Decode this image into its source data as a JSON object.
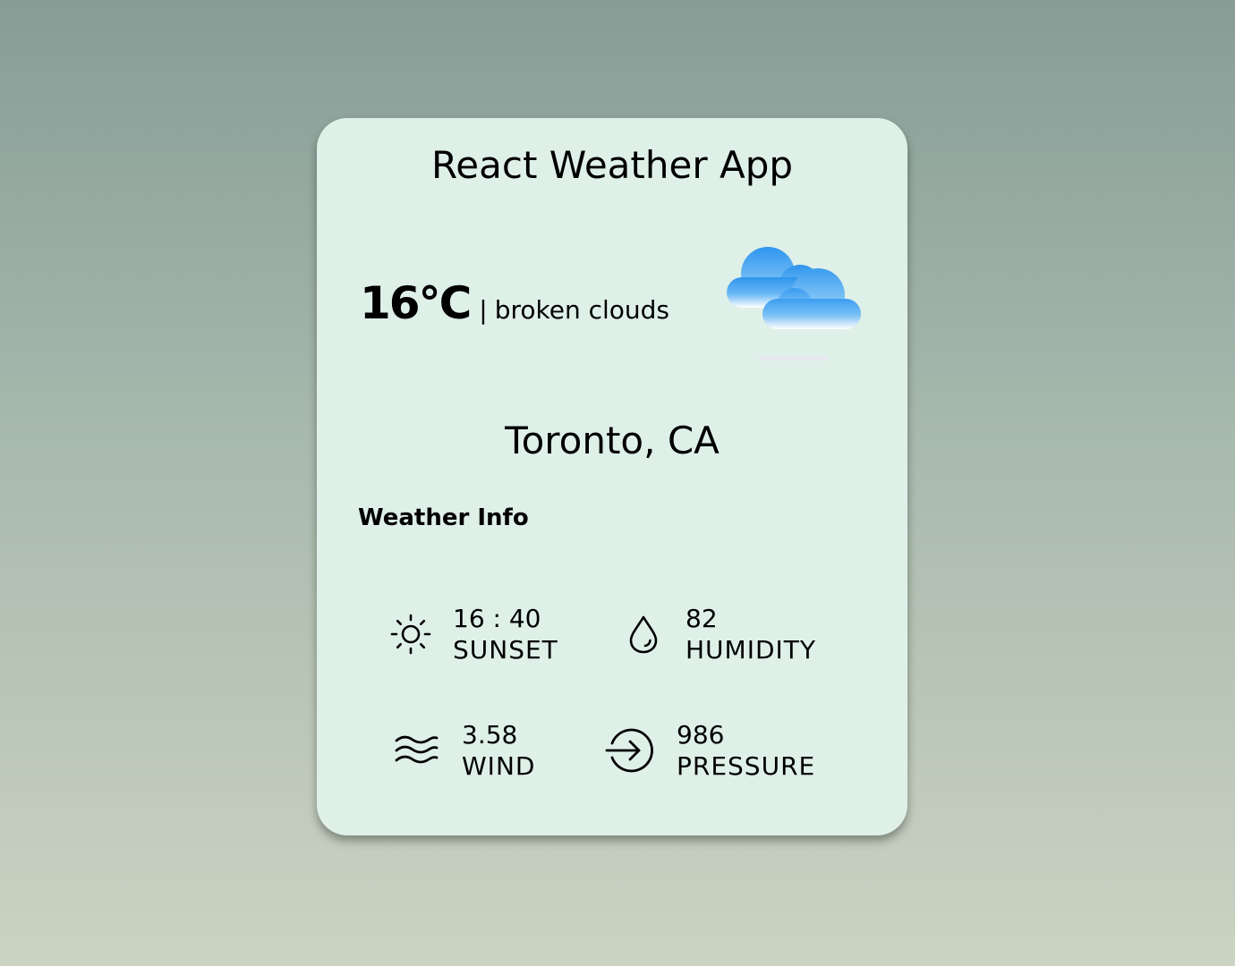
{
  "app": {
    "title": "React Weather App"
  },
  "current": {
    "temperature": "16°C",
    "separator": "|",
    "description": "broken clouds",
    "icon": "broken-clouds-icon"
  },
  "location": {
    "city": "Toronto, CA"
  },
  "info_section": {
    "label": "Weather Info",
    "items": [
      {
        "value": "16 : 40",
        "label": "SUNSET",
        "icon": "sun-icon"
      },
      {
        "value": "82",
        "label": "HUMIDITY",
        "icon": "droplet-icon"
      },
      {
        "value": "3.58",
        "label": "WIND",
        "icon": "wind-icon"
      },
      {
        "value": "986",
        "label": "PRESSURE",
        "icon": "pressure-icon"
      }
    ]
  },
  "colors": {
    "background_top": "#869d96",
    "background_bottom": "#cbd3c2",
    "card": "#dff0e8",
    "cloud_blue": "#3d9ff0"
  }
}
